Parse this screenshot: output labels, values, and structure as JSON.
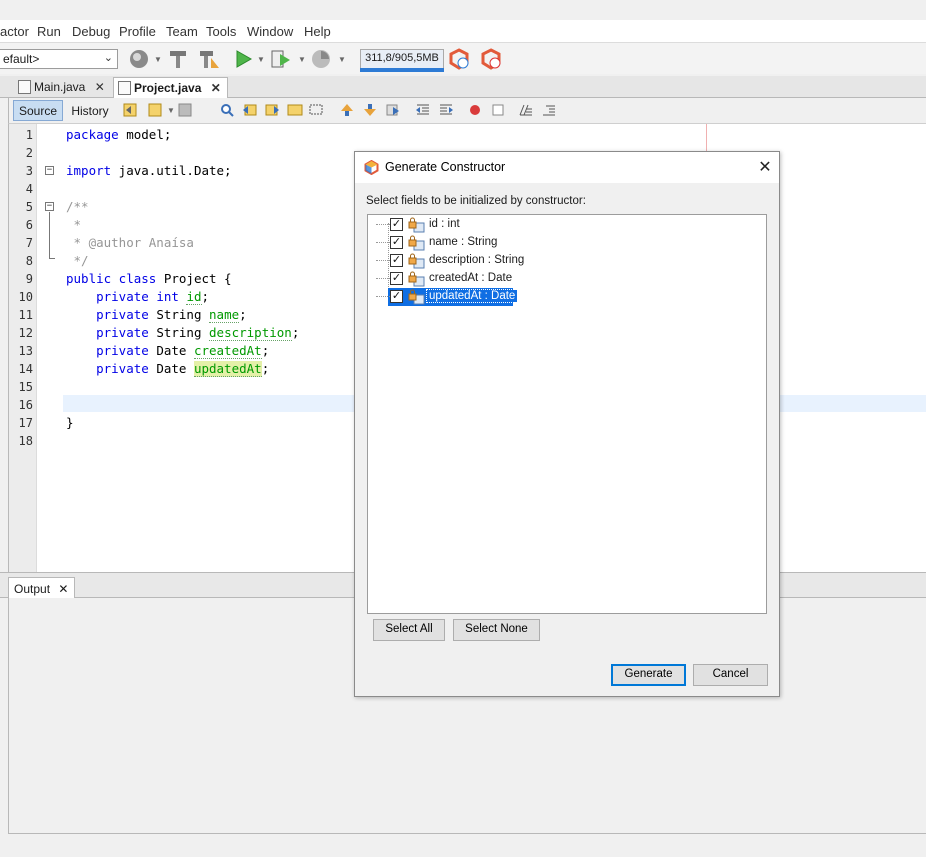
{
  "menu": [
    "actor",
    "Run",
    "Debug",
    "Profile",
    "Team",
    "Tools",
    "Window",
    "Help"
  ],
  "toolbar": {
    "config_value": "efault>",
    "memory": "311,8/905,5MB",
    "memory_fraction": 0.34
  },
  "editor_tabs": [
    {
      "label": "Main.java",
      "active": false
    },
    {
      "label": "Project.java",
      "active": true
    }
  ],
  "editor_toolbar": {
    "source_label": "Source",
    "history_label": "History"
  },
  "code": {
    "line_numbers": [
      "1",
      "2",
      "3",
      "4",
      "5",
      "6",
      "7",
      "8",
      "9",
      "10",
      "11",
      "12",
      "13",
      "14",
      "15",
      "16",
      "17",
      "18"
    ]
  },
  "output": {
    "tab_label": "Output"
  },
  "dialog": {
    "title": "Generate Constructor",
    "prompt": "Select fields to be initialized by constructor:",
    "fields": [
      {
        "label": "id : int",
        "checked": true
      },
      {
        "label": "name : String",
        "checked": true
      },
      {
        "label": "description : String",
        "checked": true
      },
      {
        "label": "createdAt : Date",
        "checked": true
      },
      {
        "label": "updatedAt : Date",
        "checked": true,
        "selected": true
      }
    ],
    "select_all": "Select All",
    "select_none": "Select None",
    "generate": "Generate",
    "cancel": "Cancel"
  },
  "colors": {
    "accent": "#0f6ee3",
    "keyword": "#0000e6",
    "field": "#009900",
    "comment": "#969696"
  }
}
